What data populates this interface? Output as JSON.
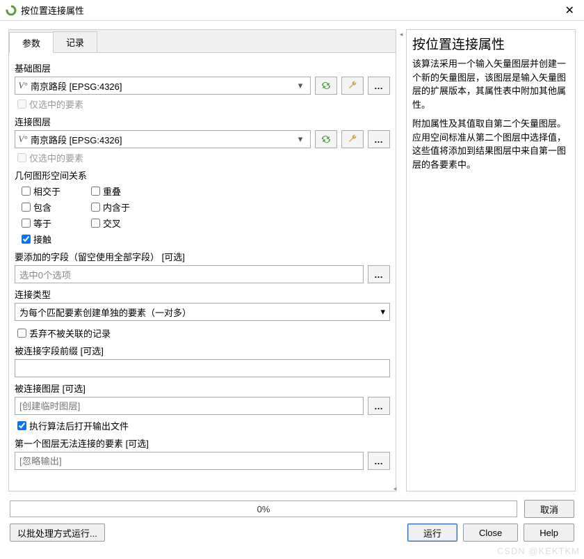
{
  "window": {
    "title": "按位置连接属性"
  },
  "tabs": {
    "params": "参数",
    "log": "记录"
  },
  "base_layer": {
    "label": "基础图层",
    "value": "南京路段 [EPSG:4326]",
    "selected_only": "仅选中的要素"
  },
  "join_layer": {
    "label": "连接图层",
    "value": "南京路段 [EPSG:4326]",
    "selected_only": "仅选中的要素"
  },
  "geom": {
    "label": "几何图形空间关系",
    "intersect": "相交于",
    "overlap": "重叠",
    "contain": "包含",
    "within": "内含于",
    "equal": "等于",
    "cross": "交叉",
    "touch": "接触"
  },
  "fields": {
    "label": "要添加的字段（留空使用全部字段） [可选]",
    "value": "选中0个选项"
  },
  "join_type": {
    "label": "连接类型",
    "value": "为每个匹配要素创建单独的要素（一对多）"
  },
  "discard": "丢弃不被关联的记录",
  "prefix": {
    "label": "被连接字段前缀 [可选]"
  },
  "joined_layer": {
    "label": "被连接图层 [可选]",
    "placeholder": "[创建临时图层]"
  },
  "open_output": "执行算法后打开输出文件",
  "unjoinable": {
    "label": "第一个图层无法连接的要素 [可选]",
    "placeholder": "[忽略输出]"
  },
  "help": {
    "title": "按位置连接属性",
    "p1": "该算法采用一个输入矢量图层并创建一个新的矢量图层，该图层是输入矢量图层的扩展版本，其属性表中附加其他属性。",
    "p2": "附加属性及其值取自第二个矢量图层。应用空间标准从第二个图层中选择值，这些值将添加到结果图层中来自第一图层的各要素中。"
  },
  "progress": "0%",
  "buttons": {
    "cancel": "取消",
    "batch": "以批处理方式运行...",
    "run": "运行",
    "close": "Close",
    "help": "Help"
  },
  "watermark": "CSDN @KEKTKM"
}
